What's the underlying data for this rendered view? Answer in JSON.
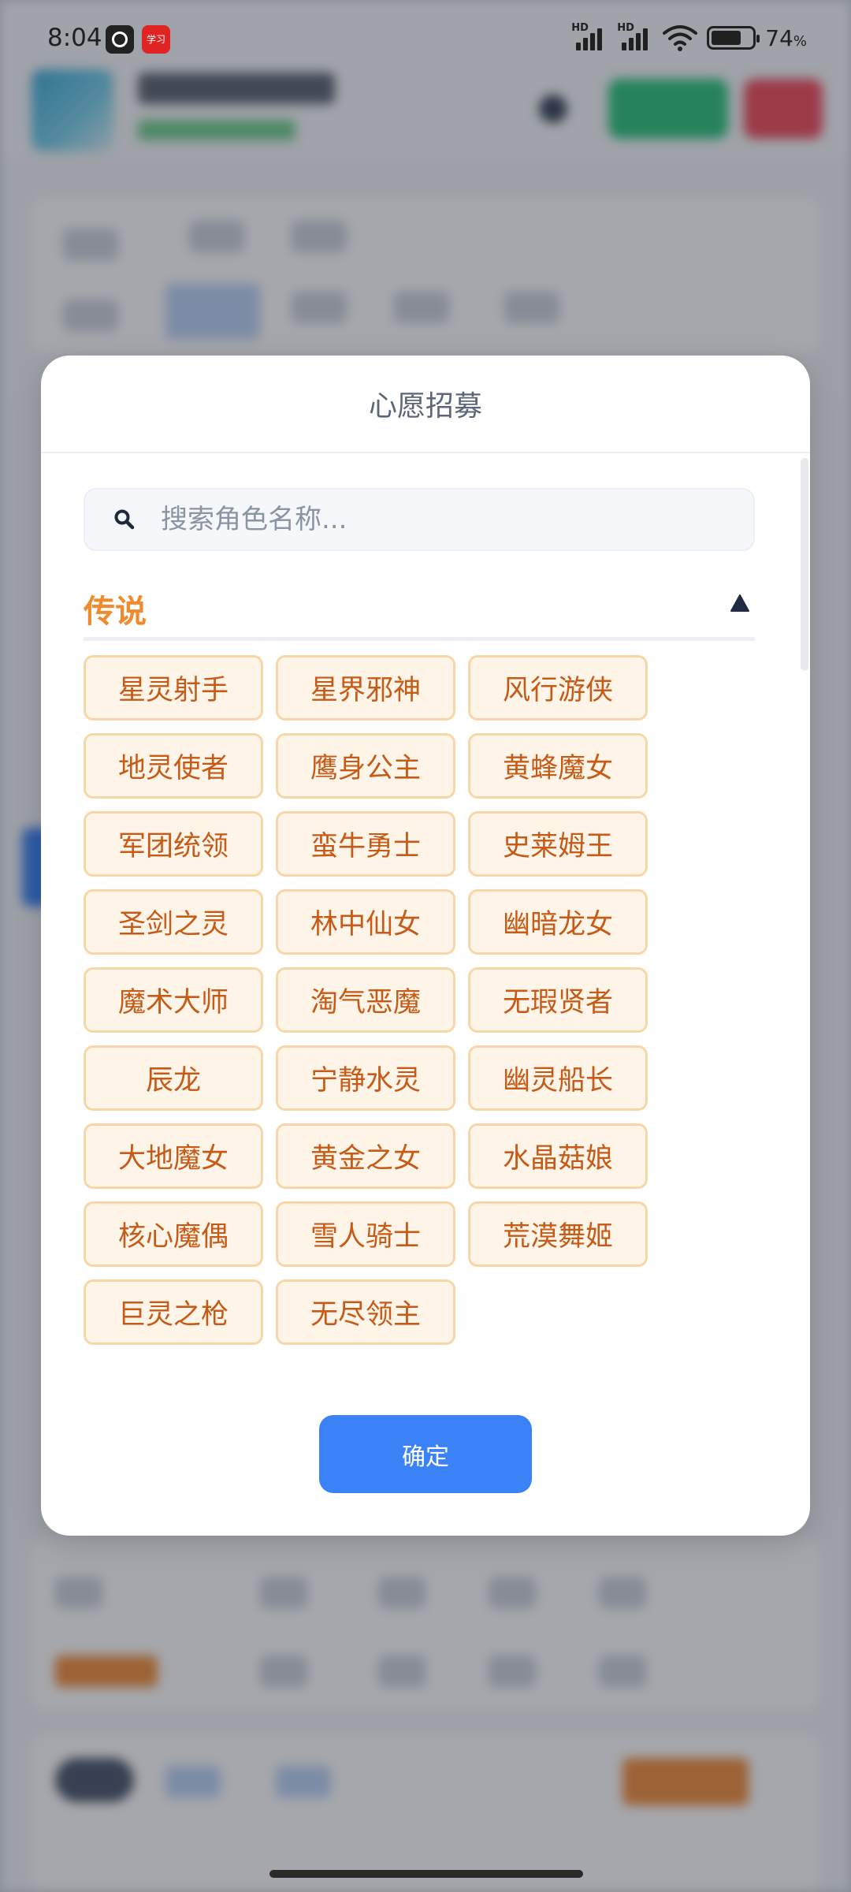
{
  "status_bar": {
    "time": "8:04",
    "app_icon_2_text": "学习",
    "network_1": "HD",
    "network_2": "HD",
    "battery_percent": "74",
    "battery_unit": "%",
    "battery_level": 0.74
  },
  "modal": {
    "title": "心愿招募",
    "search_placeholder": "搜索角色名称...",
    "section_title": "传说",
    "section_expanded": true,
    "characters": [
      "星灵射手",
      "星界邪神",
      "风行游侠",
      "地灵使者",
      "鹰身公主",
      "黄蜂魔女",
      "军团统领",
      "蛮牛勇士",
      "史莱姆王",
      "圣剑之灵",
      "林中仙女",
      "幽暗龙女",
      "魔术大师",
      "淘气恶魔",
      "无瑕贤者",
      "辰龙",
      "宁静水灵",
      "幽灵船长",
      "大地魔女",
      "黄金之女",
      "水晶菇娘",
      "核心魔偶",
      "雪人骑士",
      "荒漠舞姬",
      "巨灵之枪",
      "无尽领主"
    ],
    "confirm_label": "确定"
  },
  "colors": {
    "accent_orange": "#f08a2c",
    "chip_border": "#f7d6a8",
    "chip_bg": "#fff4e8",
    "chip_text": "#c65a17",
    "primary_blue": "#3b82f6"
  },
  "icons": {
    "search": "search-icon",
    "collapse": "triangle-up-icon"
  }
}
